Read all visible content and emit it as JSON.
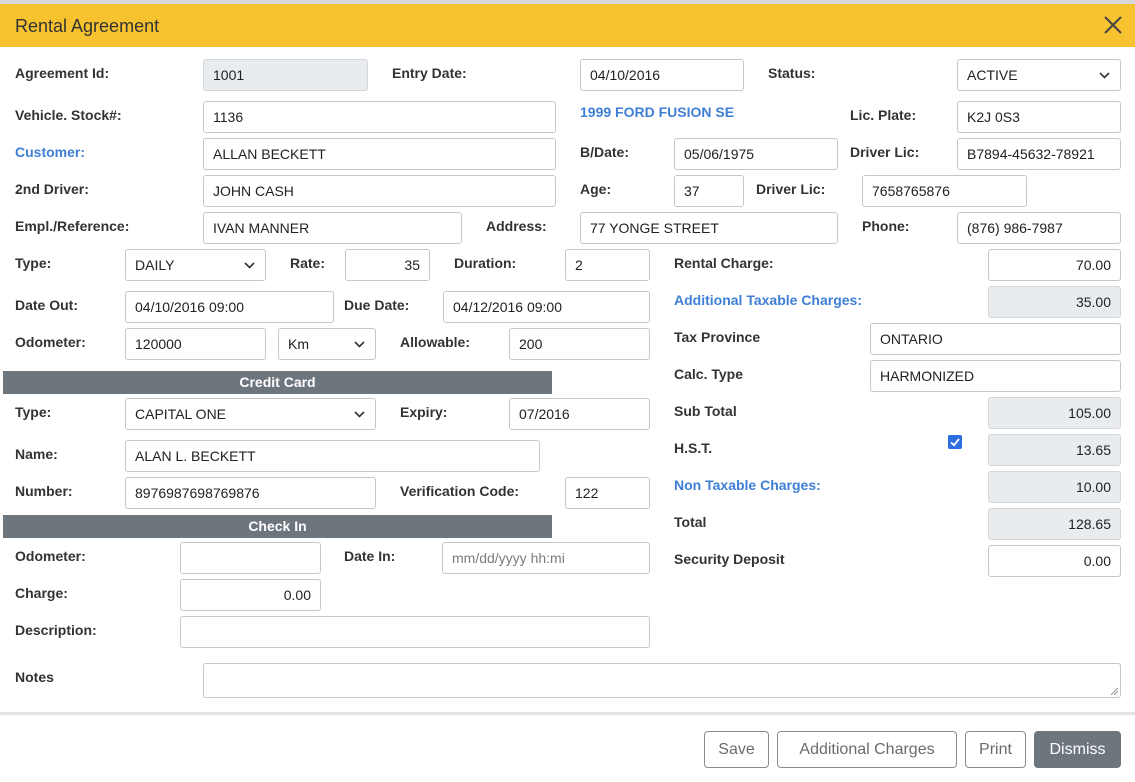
{
  "dialog": {
    "title": "Rental Agreement"
  },
  "fields": {
    "agreement_id": {
      "label": "Agreement Id:",
      "value": "1001"
    },
    "entry_date": {
      "label": "Entry Date:",
      "value": "04/10/2016"
    },
    "status": {
      "label": "Status:",
      "value": "ACTIVE"
    },
    "vehicle_stock": {
      "label": "Vehicle. Stock#:",
      "value": "1136"
    },
    "vehicle_desc": "1999 FORD FUSION SE",
    "lic_plate": {
      "label": "Lic. Plate:",
      "value": "K2J 0S3"
    },
    "customer": {
      "label": "Customer:",
      "value": "ALLAN BECKETT"
    },
    "bdate": {
      "label": "B/Date:",
      "value": "05/06/1975"
    },
    "driver_lic": {
      "label": "Driver Lic:",
      "value": "B7894-45632-78921"
    },
    "second_driver": {
      "label": "2nd Driver:",
      "value": "JOHN CASH"
    },
    "age": {
      "label": "Age:",
      "value": "37"
    },
    "driver_lic2": {
      "label": "Driver Lic:",
      "value": "7658765876"
    },
    "empl_ref": {
      "label": "Empl./Reference:",
      "value": "IVAN MANNER"
    },
    "address": {
      "label": "Address:",
      "value": "77 YONGE STREET"
    },
    "phone": {
      "label": "Phone:",
      "value": "(876) 986-7987"
    },
    "type": {
      "label": "Type:",
      "value": "DAILY"
    },
    "rate": {
      "label": "Rate:",
      "value": "35"
    },
    "duration": {
      "label": "Duration:",
      "value": "2"
    },
    "date_out": {
      "label": "Date Out:",
      "value": "04/10/2016 09:00"
    },
    "due_date": {
      "label": "Due Date:",
      "value": "04/12/2016 09:00"
    },
    "odometer": {
      "label": "Odometer:",
      "value": "120000"
    },
    "odometer_unit": "Km",
    "allowable": {
      "label": "Allowable:",
      "value": "200"
    }
  },
  "credit_card": {
    "header": "Credit Card",
    "type": {
      "label": "Type:",
      "value": "CAPITAL ONE"
    },
    "expiry": {
      "label": "Expiry:",
      "value": "07/2016"
    },
    "name": {
      "label": "Name:",
      "value": "ALAN L. BECKETT"
    },
    "number": {
      "label": "Number:",
      "value": "8976987698769876"
    },
    "verification": {
      "label": "Verification Code:",
      "value": "122"
    }
  },
  "check_in": {
    "header": "Check In",
    "odometer": {
      "label": "Odometer:",
      "value": ""
    },
    "date_in": {
      "label": "Date In:",
      "placeholder": "mm/dd/yyyy hh:mi"
    },
    "charge": {
      "label": "Charge:",
      "value": "0.00"
    },
    "description": {
      "label": "Description:",
      "value": ""
    }
  },
  "charges": {
    "rental_charge": {
      "label": "Rental Charge:",
      "value": "70.00"
    },
    "additional_taxable": {
      "label": "Additional Taxable Charges:",
      "value": "35.00"
    },
    "tax_province": {
      "label": "Tax Province",
      "value": "ONTARIO"
    },
    "calc_type": {
      "label": "Calc. Type",
      "value": "HARMONIZED"
    },
    "sub_total": {
      "label": "Sub Total",
      "value": "105.00"
    },
    "hst": {
      "label": "H.S.T.",
      "value": "13.65",
      "checked": true
    },
    "non_taxable": {
      "label": "Non Taxable Charges:",
      "value": "10.00"
    },
    "total": {
      "label": "Total",
      "value": "128.65"
    },
    "security_deposit": {
      "label": "Security Deposit",
      "value": "0.00"
    }
  },
  "notes": {
    "label": "Notes",
    "value": ""
  },
  "footer": {
    "save": "Save",
    "additional_charges": "Additional Charges",
    "print": "Print",
    "dismiss": "Dismiss"
  },
  "colors": {
    "header": "#f6c230",
    "link": "#3f7fd6",
    "section": "#6d757d",
    "readonly": "#e9ecef"
  }
}
